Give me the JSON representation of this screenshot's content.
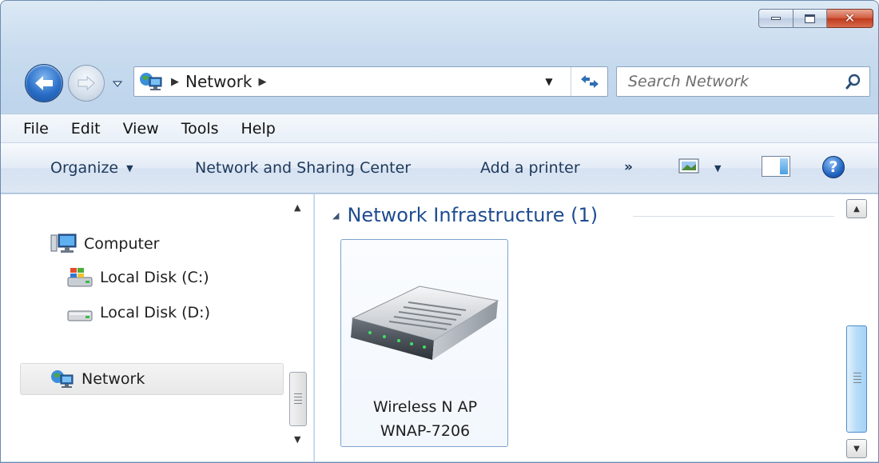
{
  "window": {
    "minimize_label": "Minimize",
    "maximize_label": "Maximize",
    "close_label": "Close"
  },
  "address_bar": {
    "crumbs": [
      "Network"
    ]
  },
  "search": {
    "placeholder": "Search Network"
  },
  "menu": {
    "items": [
      "File",
      "Edit",
      "View",
      "Tools",
      "Help"
    ]
  },
  "command_bar": {
    "organize": "Organize",
    "network_sharing": "Network and Sharing Center",
    "add_printer": "Add a printer",
    "more": "»"
  },
  "nav_pane": {
    "items": [
      {
        "label": "Computer",
        "icon": "computer-icon"
      },
      {
        "label": "Local Disk (C:)",
        "icon": "windows-drive-icon"
      },
      {
        "label": "Local Disk (D:)",
        "icon": "hard-drive-icon"
      },
      {
        "label": "Network",
        "icon": "network-icon",
        "selected": true
      }
    ]
  },
  "content": {
    "group_title": "Network Infrastructure (1)",
    "device": {
      "line1": "Wireless N AP",
      "line2": "WNAP-7206",
      "icon": "router-icon"
    }
  },
  "colors": {
    "accent": "#1e4c8f",
    "command_text": "#1e395b",
    "selection_border": "#7da2ce",
    "close_red": "#c03a1d"
  }
}
